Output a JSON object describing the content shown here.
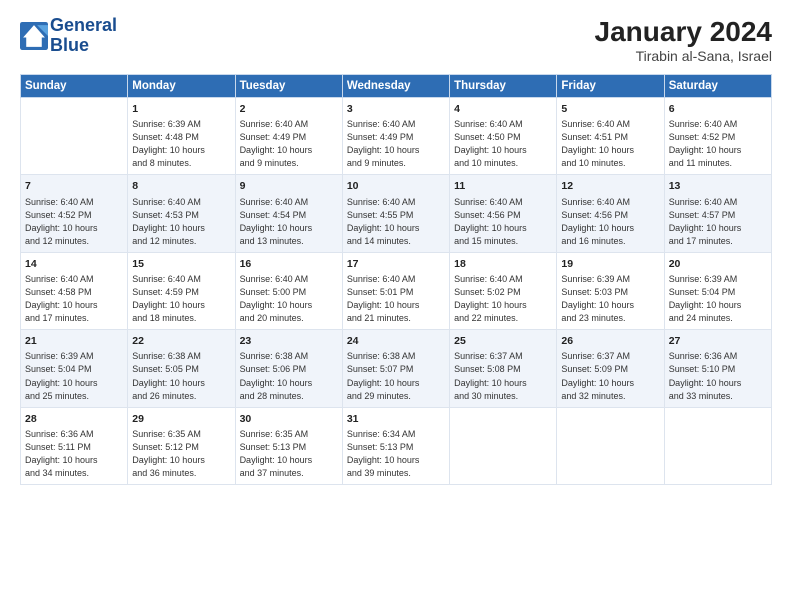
{
  "logo": {
    "line1": "General",
    "line2": "Blue"
  },
  "header": {
    "month_year": "January 2024",
    "location": "Tirabin al-Sana, Israel"
  },
  "weekdays": [
    "Sunday",
    "Monday",
    "Tuesday",
    "Wednesday",
    "Thursday",
    "Friday",
    "Saturday"
  ],
  "weeks": [
    [
      {
        "day": "",
        "content": ""
      },
      {
        "day": "1",
        "content": "Sunrise: 6:39 AM\nSunset: 4:48 PM\nDaylight: 10 hours\nand 8 minutes."
      },
      {
        "day": "2",
        "content": "Sunrise: 6:40 AM\nSunset: 4:49 PM\nDaylight: 10 hours\nand 9 minutes."
      },
      {
        "day": "3",
        "content": "Sunrise: 6:40 AM\nSunset: 4:49 PM\nDaylight: 10 hours\nand 9 minutes."
      },
      {
        "day": "4",
        "content": "Sunrise: 6:40 AM\nSunset: 4:50 PM\nDaylight: 10 hours\nand 10 minutes."
      },
      {
        "day": "5",
        "content": "Sunrise: 6:40 AM\nSunset: 4:51 PM\nDaylight: 10 hours\nand 10 minutes."
      },
      {
        "day": "6",
        "content": "Sunrise: 6:40 AM\nSunset: 4:52 PM\nDaylight: 10 hours\nand 11 minutes."
      }
    ],
    [
      {
        "day": "7",
        "content": "Sunrise: 6:40 AM\nSunset: 4:52 PM\nDaylight: 10 hours\nand 12 minutes."
      },
      {
        "day": "8",
        "content": "Sunrise: 6:40 AM\nSunset: 4:53 PM\nDaylight: 10 hours\nand 12 minutes."
      },
      {
        "day": "9",
        "content": "Sunrise: 6:40 AM\nSunset: 4:54 PM\nDaylight: 10 hours\nand 13 minutes."
      },
      {
        "day": "10",
        "content": "Sunrise: 6:40 AM\nSunset: 4:55 PM\nDaylight: 10 hours\nand 14 minutes."
      },
      {
        "day": "11",
        "content": "Sunrise: 6:40 AM\nSunset: 4:56 PM\nDaylight: 10 hours\nand 15 minutes."
      },
      {
        "day": "12",
        "content": "Sunrise: 6:40 AM\nSunset: 4:56 PM\nDaylight: 10 hours\nand 16 minutes."
      },
      {
        "day": "13",
        "content": "Sunrise: 6:40 AM\nSunset: 4:57 PM\nDaylight: 10 hours\nand 17 minutes."
      }
    ],
    [
      {
        "day": "14",
        "content": "Sunrise: 6:40 AM\nSunset: 4:58 PM\nDaylight: 10 hours\nand 17 minutes."
      },
      {
        "day": "15",
        "content": "Sunrise: 6:40 AM\nSunset: 4:59 PM\nDaylight: 10 hours\nand 18 minutes."
      },
      {
        "day": "16",
        "content": "Sunrise: 6:40 AM\nSunset: 5:00 PM\nDaylight: 10 hours\nand 20 minutes."
      },
      {
        "day": "17",
        "content": "Sunrise: 6:40 AM\nSunset: 5:01 PM\nDaylight: 10 hours\nand 21 minutes."
      },
      {
        "day": "18",
        "content": "Sunrise: 6:40 AM\nSunset: 5:02 PM\nDaylight: 10 hours\nand 22 minutes."
      },
      {
        "day": "19",
        "content": "Sunrise: 6:39 AM\nSunset: 5:03 PM\nDaylight: 10 hours\nand 23 minutes."
      },
      {
        "day": "20",
        "content": "Sunrise: 6:39 AM\nSunset: 5:04 PM\nDaylight: 10 hours\nand 24 minutes."
      }
    ],
    [
      {
        "day": "21",
        "content": "Sunrise: 6:39 AM\nSunset: 5:04 PM\nDaylight: 10 hours\nand 25 minutes."
      },
      {
        "day": "22",
        "content": "Sunrise: 6:38 AM\nSunset: 5:05 PM\nDaylight: 10 hours\nand 26 minutes."
      },
      {
        "day": "23",
        "content": "Sunrise: 6:38 AM\nSunset: 5:06 PM\nDaylight: 10 hours\nand 28 minutes."
      },
      {
        "day": "24",
        "content": "Sunrise: 6:38 AM\nSunset: 5:07 PM\nDaylight: 10 hours\nand 29 minutes."
      },
      {
        "day": "25",
        "content": "Sunrise: 6:37 AM\nSunset: 5:08 PM\nDaylight: 10 hours\nand 30 minutes."
      },
      {
        "day": "26",
        "content": "Sunrise: 6:37 AM\nSunset: 5:09 PM\nDaylight: 10 hours\nand 32 minutes."
      },
      {
        "day": "27",
        "content": "Sunrise: 6:36 AM\nSunset: 5:10 PM\nDaylight: 10 hours\nand 33 minutes."
      }
    ],
    [
      {
        "day": "28",
        "content": "Sunrise: 6:36 AM\nSunset: 5:11 PM\nDaylight: 10 hours\nand 34 minutes."
      },
      {
        "day": "29",
        "content": "Sunrise: 6:35 AM\nSunset: 5:12 PM\nDaylight: 10 hours\nand 36 minutes."
      },
      {
        "day": "30",
        "content": "Sunrise: 6:35 AM\nSunset: 5:13 PM\nDaylight: 10 hours\nand 37 minutes."
      },
      {
        "day": "31",
        "content": "Sunrise: 6:34 AM\nSunset: 5:13 PM\nDaylight: 10 hours\nand 39 minutes."
      },
      {
        "day": "",
        "content": ""
      },
      {
        "day": "",
        "content": ""
      },
      {
        "day": "",
        "content": ""
      }
    ]
  ]
}
